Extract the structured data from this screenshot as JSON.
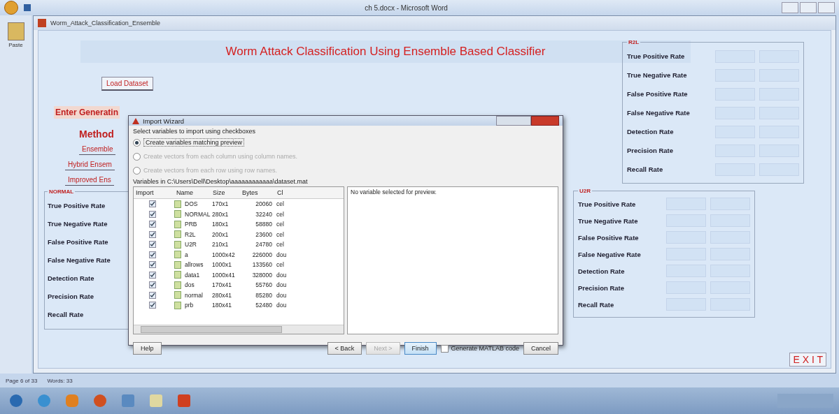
{
  "word_window": {
    "title": "ch 5.docx - Microsoft Word",
    "ribbon_label": "Paste"
  },
  "figure_window": {
    "title": "Worm_Attack_Classification_Ensemble"
  },
  "app": {
    "title": "Worm Attack Classification Using Ensemble Based Classifier",
    "load_button": "Load Dataset",
    "generating_label": "Enter Generatin",
    "method_label": "Method",
    "method_buttons": [
      "Ensemble",
      "Hybrid Ensem",
      "Improved Ens"
    ],
    "exit_button": "E X I T"
  },
  "panels": [
    {
      "kind": "left",
      "title": "NORMAL",
      "rows": [
        "True Positive Rate",
        "True Negative Rate",
        "False Positive Rate",
        "False Negative Rate",
        "Detection Rate",
        "Precision Rate",
        "Recall Rate"
      ]
    },
    {
      "kind": "right",
      "title": "R2L",
      "rows": [
        "True Positive Rate",
        "True Negative Rate",
        "False Positive Rate",
        "False Negative Rate",
        "Detection Rate",
        "Precision Rate",
        "Recall Rate"
      ]
    },
    {
      "kind": "middle",
      "title": "U2R",
      "rows": [
        "True Positive Rate",
        "True Negative Rate",
        "False Positive Rate",
        "False Negative Rate",
        "Detection Rate",
        "Precision Rate",
        "Recall Rate"
      ]
    }
  ],
  "dialog": {
    "title": "Import Wizard",
    "instruction": "Select variables to import using checkboxes",
    "options": [
      {
        "label": "Create variables matching preview",
        "selected": true,
        "disabled": false
      },
      {
        "label": "Create vectors from each column using column names.",
        "selected": false,
        "disabled": true
      },
      {
        "label": "Create vectors from each row using row names.",
        "selected": false,
        "disabled": true
      }
    ],
    "path": "Variables in C:\\Users\\Dell\\Desktop\\aaaaaaaaaaaa\\dataset.mat",
    "columns": [
      "Import",
      "Name",
      "Size",
      "Bytes",
      "Cl"
    ],
    "rows": [
      {
        "checked": true,
        "name": "DOS",
        "size": "170x1",
        "bytes": "20060",
        "class": "cel"
      },
      {
        "checked": true,
        "name": "NORMAL",
        "size": "280x1",
        "bytes": "32240",
        "class": "cel"
      },
      {
        "checked": true,
        "name": "PRB",
        "size": "180x1",
        "bytes": "58880",
        "class": "cel"
      },
      {
        "checked": true,
        "name": "R2L",
        "size": "200x1",
        "bytes": "23600",
        "class": "cel"
      },
      {
        "checked": true,
        "name": "U2R",
        "size": "210x1",
        "bytes": "24780",
        "class": "cel"
      },
      {
        "checked": true,
        "name": "a",
        "size": "1000x42",
        "bytes": "226000",
        "class": "dou"
      },
      {
        "checked": true,
        "name": "allrows",
        "size": "1000x1",
        "bytes": "133560",
        "class": "cel"
      },
      {
        "checked": true,
        "name": "data1",
        "size": "1000x41",
        "bytes": "328000",
        "class": "dou"
      },
      {
        "checked": true,
        "name": "dos",
        "size": "170x41",
        "bytes": "55760",
        "class": "dou"
      },
      {
        "checked": true,
        "name": "normal",
        "size": "280x41",
        "bytes": "85280",
        "class": "dou"
      },
      {
        "checked": true,
        "name": "prb",
        "size": "180x41",
        "bytes": "52480",
        "class": "dou"
      }
    ],
    "preview": "No variable selected for preview.",
    "help": "Help",
    "back": "< Back",
    "next": {
      "label": "Next >",
      "disabled": true
    },
    "finish": "Finish",
    "generate": {
      "label": "Generate MATLAB code",
      "checked": false
    },
    "cancel": "Cancel"
  },
  "status_bar": {
    "page": "Page 6 of 33",
    "words": "Words: 33"
  }
}
